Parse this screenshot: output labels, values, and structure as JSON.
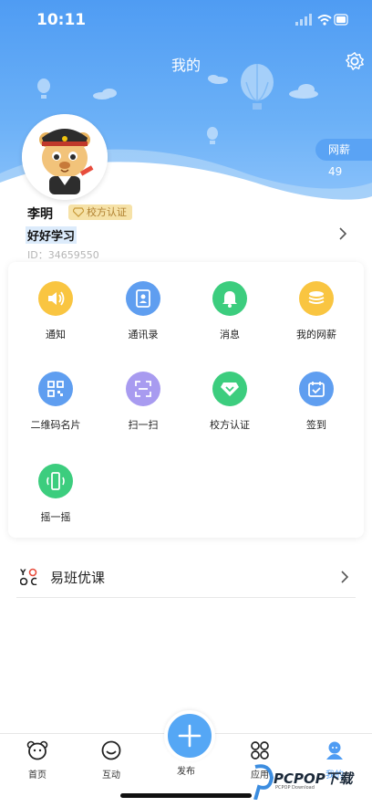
{
  "status_bar": {
    "time": "10:11"
  },
  "header": {
    "title": "我的",
    "wage_badge": "网薪 49"
  },
  "profile": {
    "name": "李明",
    "certification_badge": "校方认证",
    "motto": "好好学习",
    "user_id": "ID：34659550"
  },
  "functions": [
    {
      "label": "通知",
      "icon": "speaker-icon",
      "color": "#f9c541"
    },
    {
      "label": "通讯录",
      "icon": "contacts-icon",
      "color": "#5f9ef0"
    },
    {
      "label": "消息",
      "icon": "bell-icon",
      "color": "#3ccd7e"
    },
    {
      "label": "我的网薪",
      "icon": "coins-icon",
      "color": "#f9c541"
    },
    {
      "label": "二维码名片",
      "icon": "qrcode-icon",
      "color": "#5f9ef0"
    },
    {
      "label": "扫一扫",
      "icon": "scan-icon",
      "color": "#a89bf0"
    },
    {
      "label": "校方认证",
      "icon": "diamond-icon",
      "color": "#3ccd7e"
    },
    {
      "label": "签到",
      "icon": "calendar-check-icon",
      "color": "#5f9ef0"
    },
    {
      "label": "摇一摇",
      "icon": "shake-phone-icon",
      "color": "#3ccd7e"
    }
  ],
  "course": {
    "label": "易班优课",
    "logo_text": "YO oC"
  },
  "tabbar": {
    "tabs": [
      {
        "label": "首页",
        "icon": "bear-home-icon"
      },
      {
        "label": "互动",
        "icon": "smile-icon"
      },
      {
        "label": "发布",
        "icon": "plus-icon"
      },
      {
        "label": "应用",
        "icon": "apps-icon"
      },
      {
        "label": "我的",
        "icon": "user-icon",
        "active": true
      }
    ]
  },
  "watermark": {
    "text": "PCPOP下载",
    "sub": "PCPOP Download"
  },
  "colors": {
    "primary": "#4f9cf3",
    "active_tab": "#4f9cf3"
  }
}
